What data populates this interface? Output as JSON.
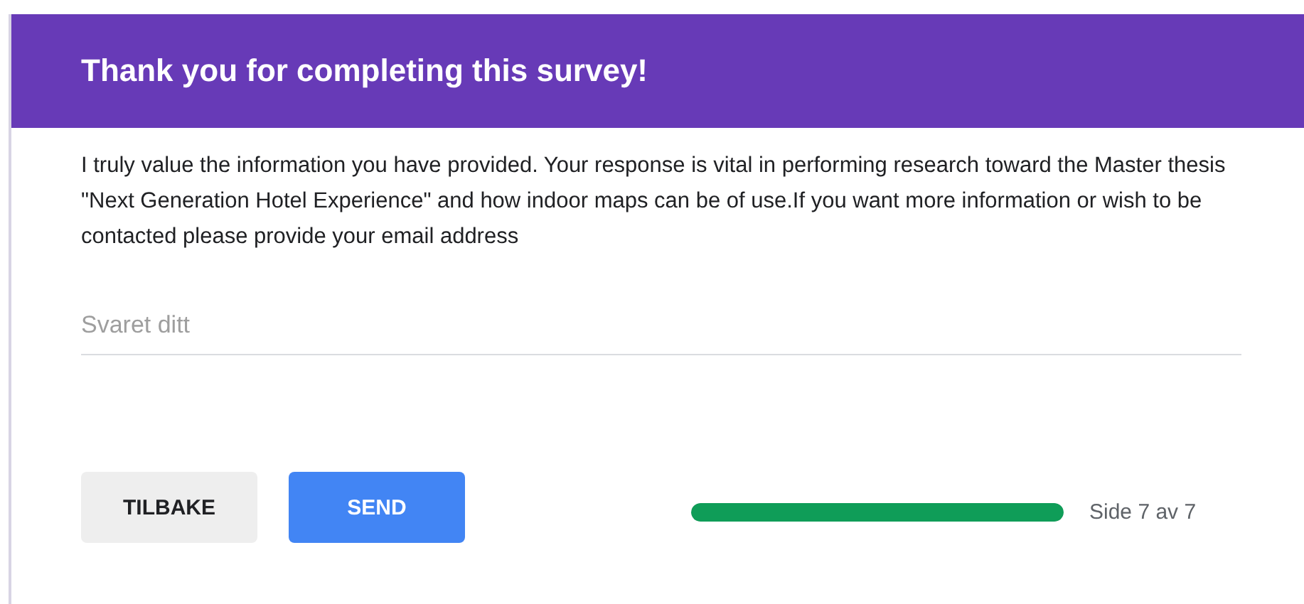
{
  "header": {
    "title": "Thank you for completing this survey!"
  },
  "description": "I truly value the information you have provided. Your response is vital in performing research toward the Master thesis \"Next Generation Hotel Experience\" and how indoor maps can be of use.If you want more information or wish to be contacted please provide your email address",
  "answer": {
    "placeholder": "Svaret ditt"
  },
  "buttons": [
    {
      "label": "TILBAKE",
      "kind": "secondary"
    },
    {
      "label": "SEND",
      "kind": "primary"
    }
  ],
  "progress": {
    "level": 1,
    "label": "Side 7 av 7"
  }
}
